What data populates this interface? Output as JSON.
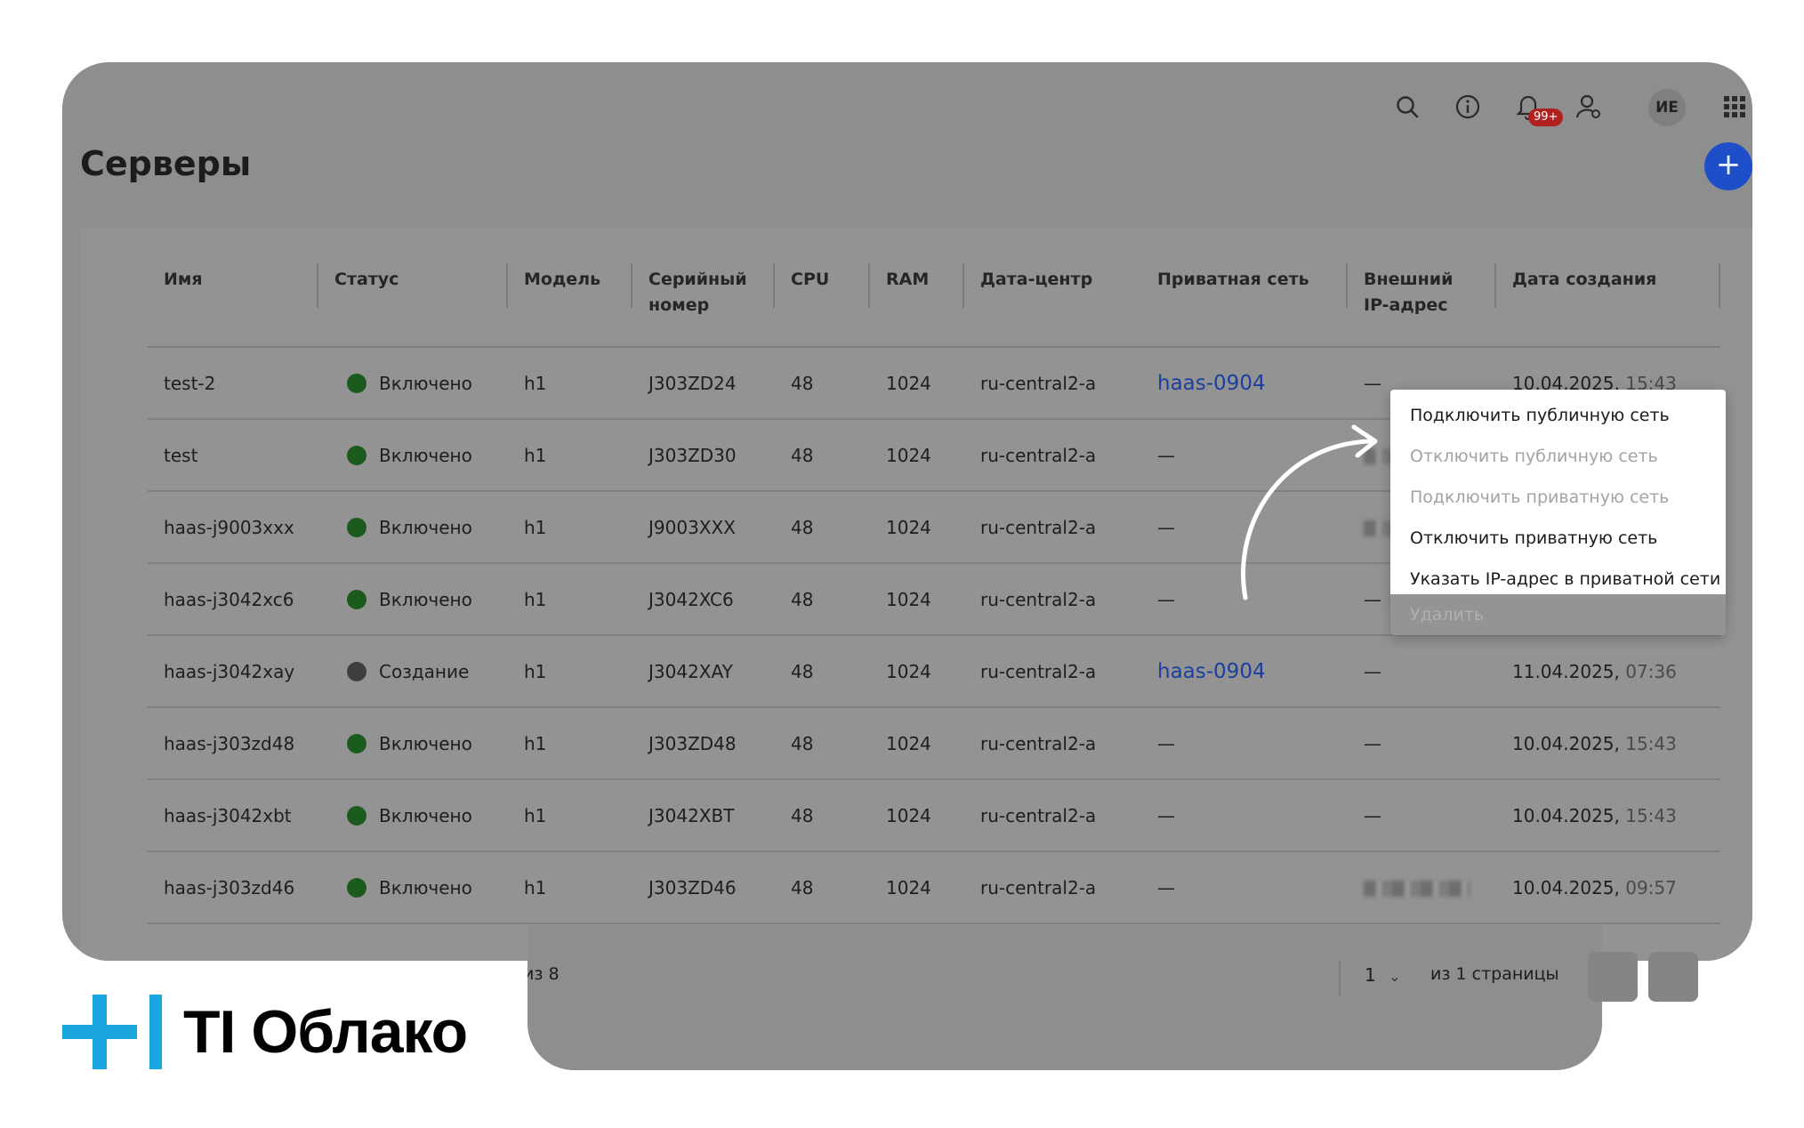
{
  "page": {
    "title": "Серверы",
    "add_button": "+"
  },
  "topbar": {
    "icons": [
      "search-icon",
      "info-icon",
      "bell-icon",
      "user-settings-icon",
      "apps-grid-icon"
    ],
    "notifications_badge": "99+",
    "avatar_initials": "ИЕ"
  },
  "table": {
    "columns": [
      "Имя",
      "Статус",
      "Модель",
      "Серийный номер",
      "CPU",
      "RAM",
      "Дата-центр",
      "Приватная сеть",
      "Внешний IP-адрес",
      "Дата создания"
    ],
    "rows": [
      {
        "name": "test-2",
        "status": "Включено",
        "status_state": "on",
        "model": "h1",
        "serial": "J303ZD24",
        "cpu": "48",
        "ram": "1024",
        "dc": "ru-central2-a",
        "private_net": "haas-0904",
        "private_is_link": true,
        "ext_ip": "—",
        "ext_ip_blurred": false,
        "date": "10.04.2025,",
        "time": "15:43"
      },
      {
        "name": "test",
        "status": "Включено",
        "status_state": "on",
        "model": "h1",
        "serial": "J303ZD30",
        "cpu": "48",
        "ram": "1024",
        "dc": "ru-central2-a",
        "private_net": "—",
        "private_is_link": false,
        "ext_ip": "",
        "ext_ip_blurred": true,
        "date": "",
        "time": ""
      },
      {
        "name": "haas-j9003xxx",
        "status": "Включено",
        "status_state": "on",
        "model": "h1",
        "serial": "J9003XXX",
        "cpu": "48",
        "ram": "1024",
        "dc": "ru-central2-a",
        "private_net": "—",
        "private_is_link": false,
        "ext_ip": "",
        "ext_ip_blurred": true,
        "date": "",
        "time": ""
      },
      {
        "name": "haas-j3042xc6",
        "status": "Включено",
        "status_state": "on",
        "model": "h1",
        "serial": "J3042XC6",
        "cpu": "48",
        "ram": "1024",
        "dc": "ru-central2-a",
        "private_net": "—",
        "private_is_link": false,
        "ext_ip": "—",
        "ext_ip_blurred": false,
        "date": "",
        "time": ""
      },
      {
        "name": "haas-j3042xay",
        "status": "Создание",
        "status_state": "creating",
        "model": "h1",
        "serial": "J3042XAY",
        "cpu": "48",
        "ram": "1024",
        "dc": "ru-central2-a",
        "private_net": "haas-0904",
        "private_is_link": true,
        "ext_ip": "—",
        "ext_ip_blurred": false,
        "date": "11.04.2025,",
        "time": "07:36"
      },
      {
        "name": "haas-j303zd48",
        "status": "Включено",
        "status_state": "on",
        "model": "h1",
        "serial": "J303ZD48",
        "cpu": "48",
        "ram": "1024",
        "dc": "ru-central2-a",
        "private_net": "—",
        "private_is_link": false,
        "ext_ip": "—",
        "ext_ip_blurred": false,
        "date": "10.04.2025,",
        "time": "15:43"
      },
      {
        "name": "haas-j3042xbt",
        "status": "Включено",
        "status_state": "on",
        "model": "h1",
        "serial": "J3042XBT",
        "cpu": "48",
        "ram": "1024",
        "dc": "ru-central2-a",
        "private_net": "—",
        "private_is_link": false,
        "ext_ip": "—",
        "ext_ip_blurred": false,
        "date": "10.04.2025,",
        "time": "15:43"
      },
      {
        "name": "haas-j303zd46",
        "status": "Включено",
        "status_state": "on",
        "model": "h1",
        "serial": "J303ZD46",
        "cpu": "48",
        "ram": "1024",
        "dc": "ru-central2-a",
        "private_net": "—",
        "private_is_link": false,
        "ext_ip": "",
        "ext_ip_blurred": true,
        "date": "10.04.2025,",
        "time": "09:57"
      }
    ]
  },
  "footer": {
    "count_text": "из 8",
    "page_select": "1",
    "page_of": "из 1 страницы"
  },
  "context_menu": {
    "items": [
      {
        "label": "Подключить публичную сеть",
        "disabled": false
      },
      {
        "label": "Отключить публичную сеть",
        "disabled": true
      },
      {
        "label": "Подключить приватную сеть",
        "disabled": true
      },
      {
        "label": "Отключить приватную сеть",
        "disabled": false
      },
      {
        "label": "Указать IP-адрес в приватной сети",
        "disabled": false
      }
    ],
    "delete_label": "Удалить"
  },
  "brand": {
    "logo_text": "TI Облако",
    "accent_color": "#1aa7e0"
  }
}
